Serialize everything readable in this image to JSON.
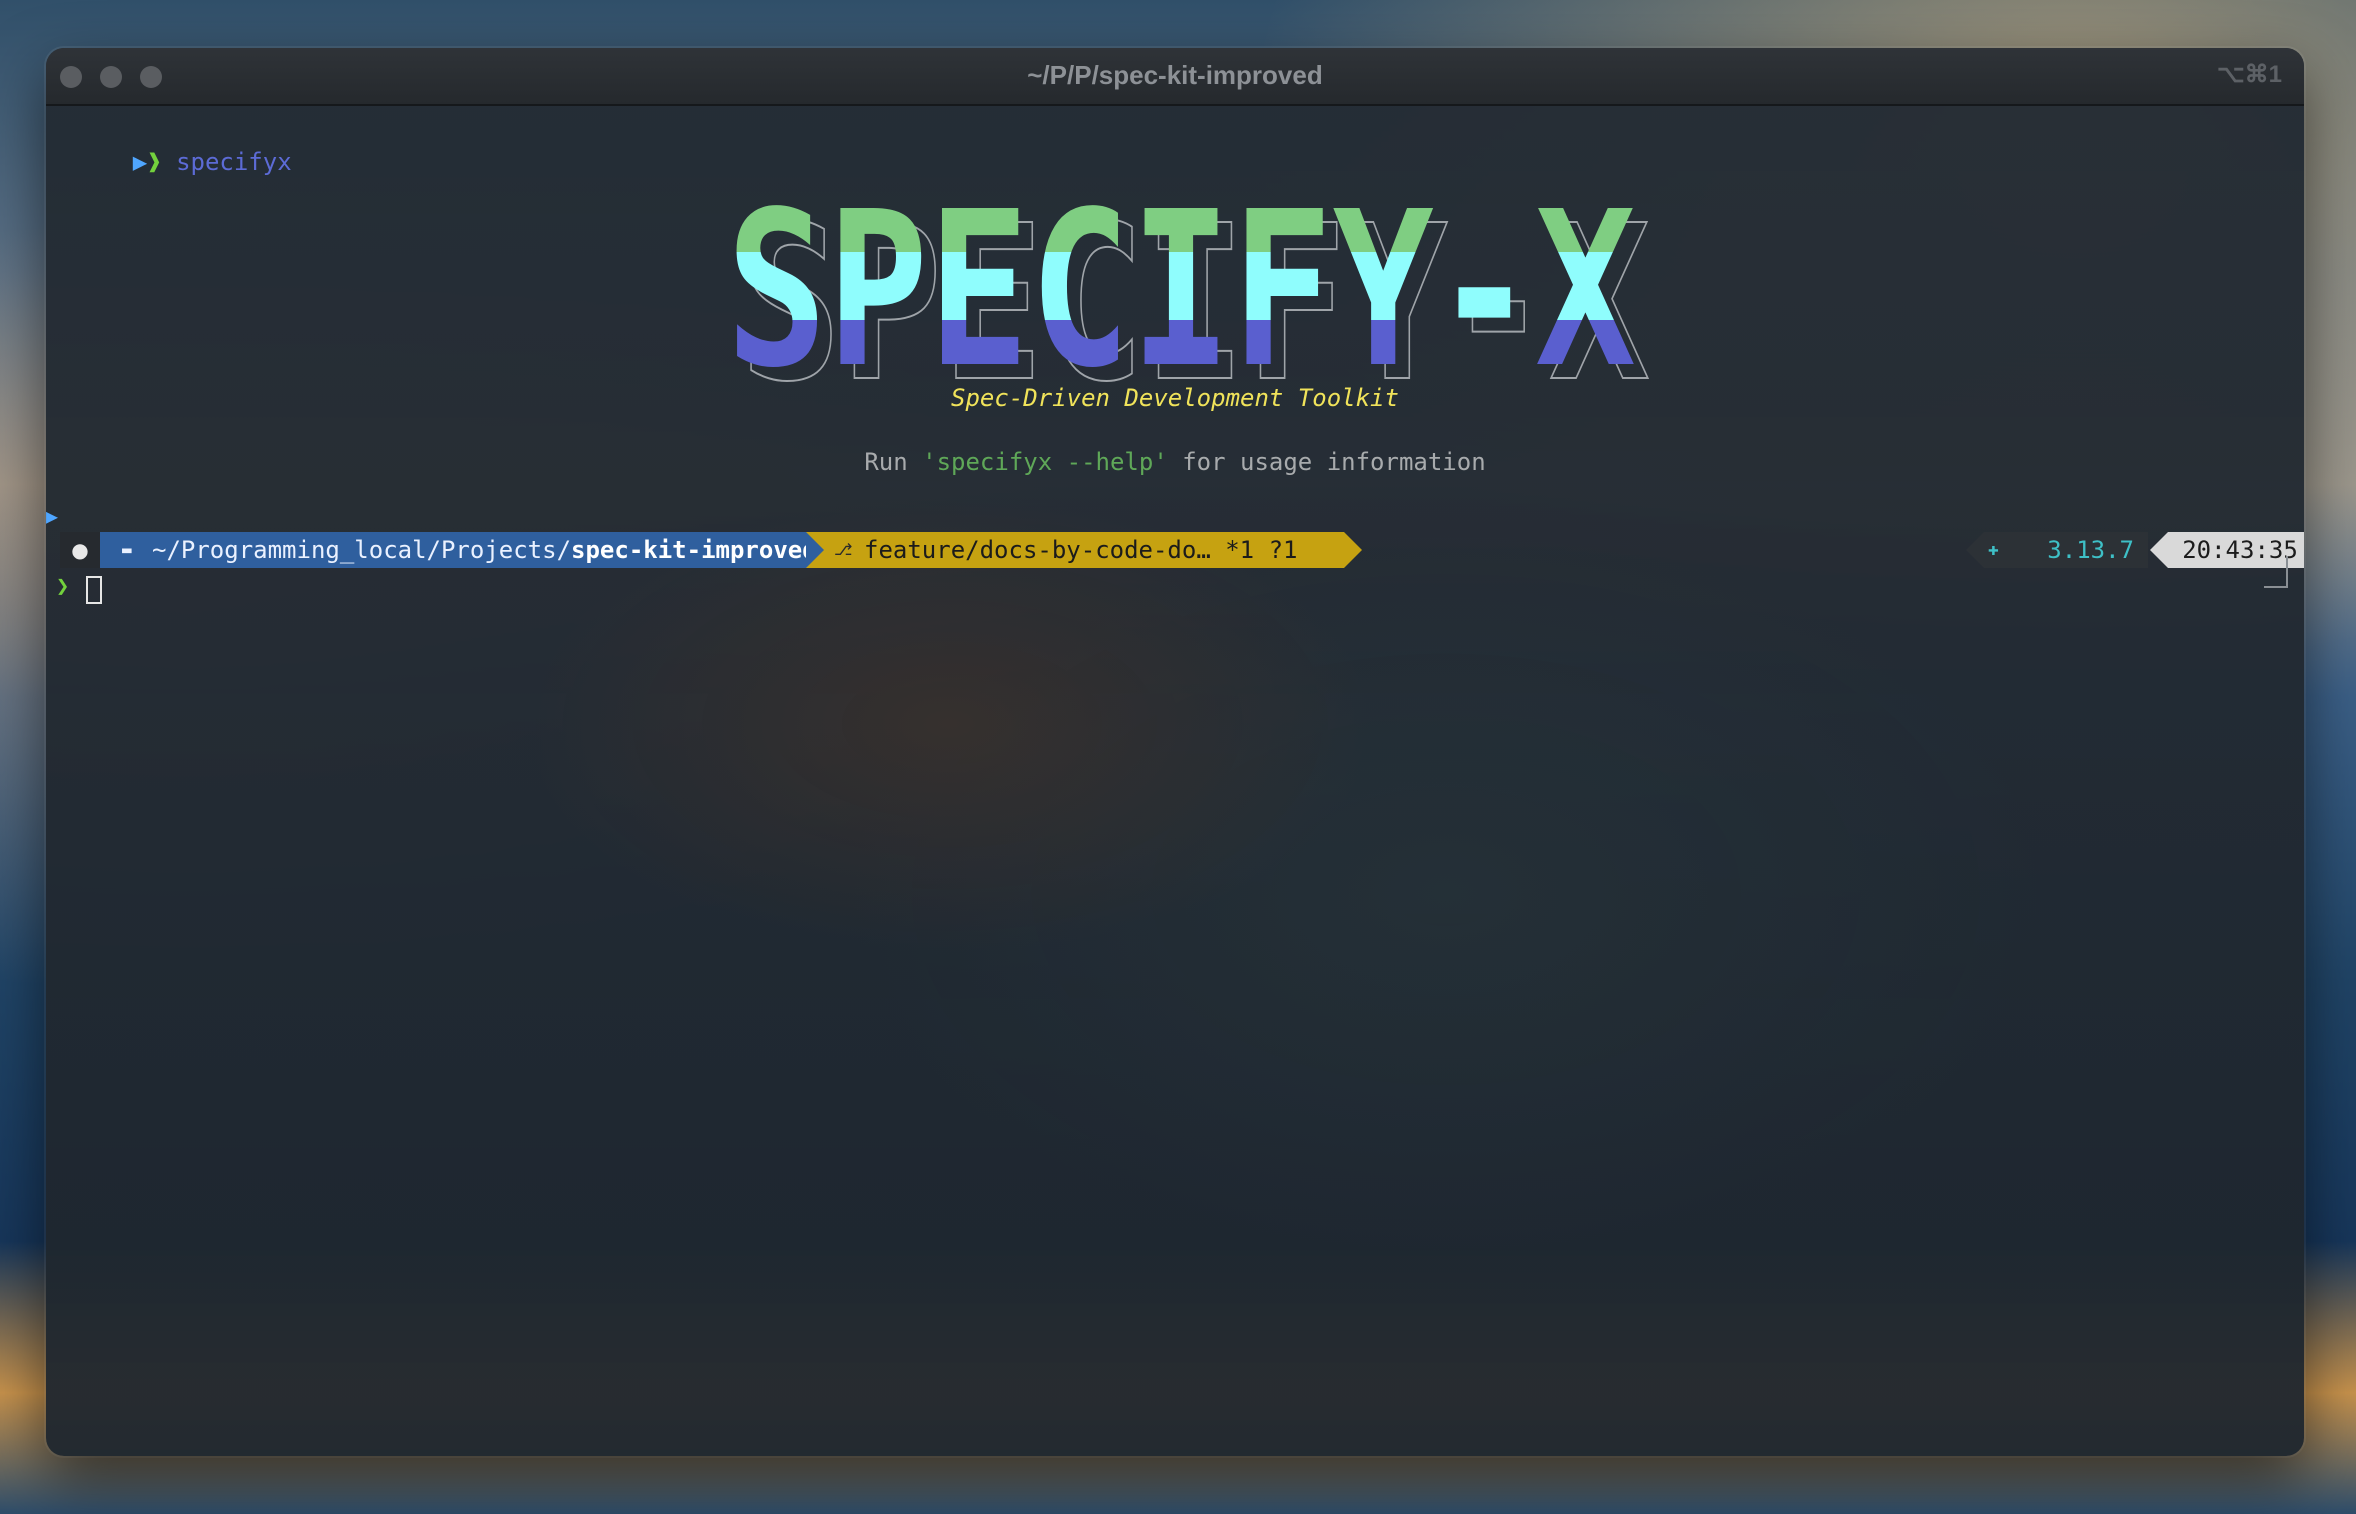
{
  "window": {
    "title": "~/P/P/spec-kit-improved",
    "shortcut": "⌥⌘1"
  },
  "terminal": {
    "first_prompt_glyph": "❱",
    "command": "specifyx",
    "banner_text": "SPECIFY-X",
    "tagline": "Spec-Driven Development Toolkit",
    "help_prefix": "Run ",
    "help_command": "'specifyx --help'",
    "help_suffix": " for usage information",
    "second_prompt_glyph": "❯"
  },
  "prompt": {
    "apple_icon": "apple-icon",
    "path_prefix": "~/Programming_local/Projects/",
    "path_current": "spec-kit-improved",
    "git_label": "feature/docs-by-code-do… *1 ?1",
    "python_version": "3.13.7",
    "time": "20:43:35"
  },
  "colors": {
    "banner_top": "#7fce82",
    "banner_mid": "#8ffdfd",
    "banner_bottom": "#5a5fcf",
    "path_bg": "#2f5f9e",
    "git_bg": "#c6a211"
  }
}
